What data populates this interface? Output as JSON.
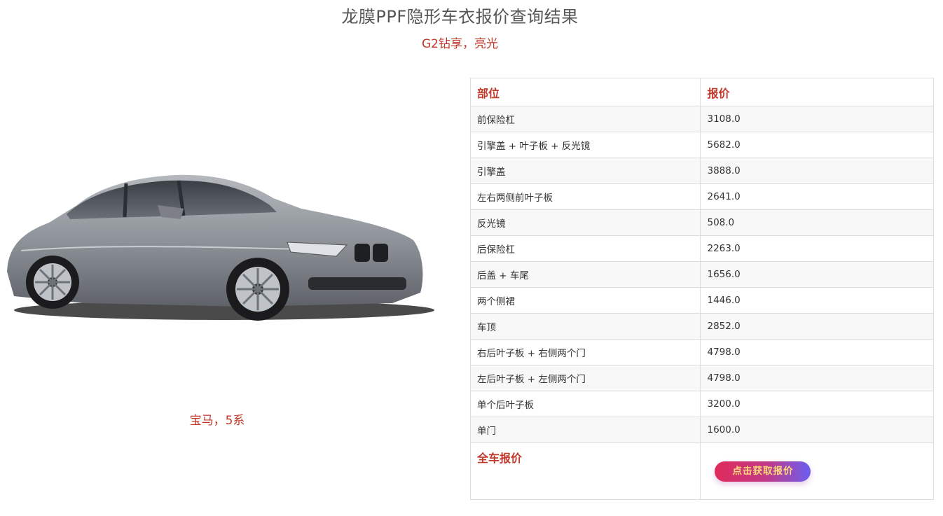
{
  "header": {
    "title": "龙膜PPF隐形车衣报价查询结果",
    "subtitle": "G2钻享，亮光"
  },
  "car": {
    "caption": "宝马，5系",
    "body_color": "#8e9399"
  },
  "table": {
    "headers": [
      "部位",
      "报价"
    ],
    "rows": [
      {
        "part": "前保险杠",
        "price": "3108.0"
      },
      {
        "part": "引擎盖 + 叶子板 + 反光镜",
        "price": "5682.0"
      },
      {
        "part": "引擎盖",
        "price": "3888.0"
      },
      {
        "part": "左右两侧前叶子板",
        "price": "2641.0"
      },
      {
        "part": "反光镜",
        "price": "508.0"
      },
      {
        "part": "后保险杠",
        "price": "2263.0"
      },
      {
        "part": "后盖 + 车尾",
        "price": "1656.0"
      },
      {
        "part": "两个侧裙",
        "price": "1446.0"
      },
      {
        "part": "车顶",
        "price": "2852.0"
      },
      {
        "part": "右后叶子板 + 右侧两个门",
        "price": "4798.0"
      },
      {
        "part": "左后叶子板 + 左侧两个门",
        "price": "4798.0"
      },
      {
        "part": "单个后叶子板",
        "price": "3200.0"
      },
      {
        "part": "单门",
        "price": "1600.0"
      }
    ],
    "total_label": "全车报价",
    "quote_button_label": "点击获取报价"
  },
  "colors": {
    "accent": "#c0392b",
    "button_start": "#e02a5a",
    "button_end": "#6a5ef0",
    "button_text": "#ffd97a"
  }
}
